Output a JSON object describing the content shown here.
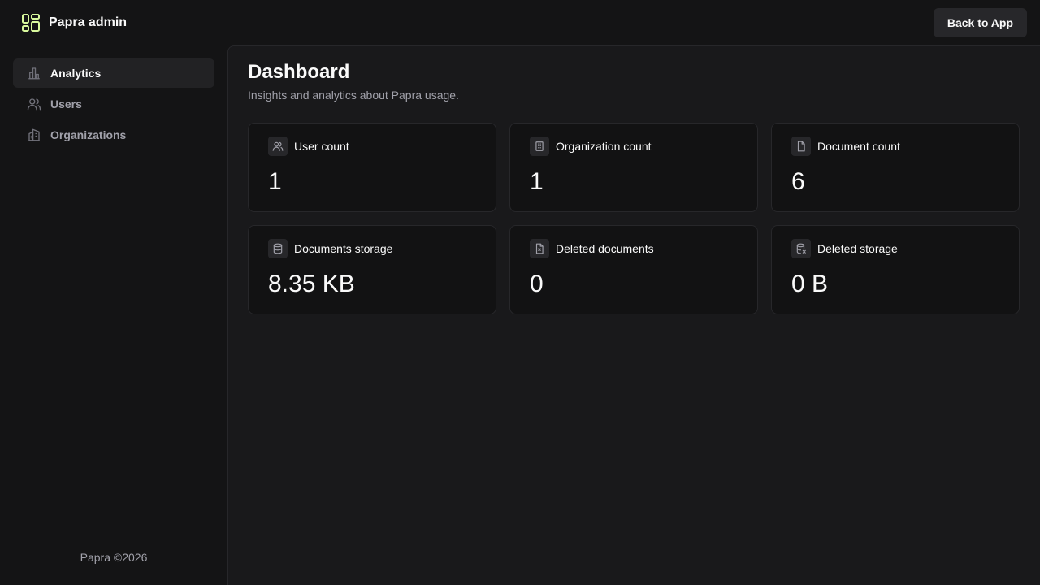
{
  "header": {
    "app_title": "Papra admin",
    "back_button_label": "Back to App"
  },
  "sidebar": {
    "items": [
      {
        "label": "Analytics",
        "icon": "bar-chart-icon",
        "active": true
      },
      {
        "label": "Users",
        "icon": "users-icon",
        "active": false
      },
      {
        "label": "Organizations",
        "icon": "buildings-icon",
        "active": false
      }
    ],
    "footer": "Papra ©2026"
  },
  "main": {
    "title": "Dashboard",
    "subtitle": "Insights and analytics about Papra usage.",
    "stats": [
      {
        "label": "User count",
        "value": "1",
        "icon": "users-icon"
      },
      {
        "label": "Organization count",
        "value": "1",
        "icon": "building-icon"
      },
      {
        "label": "Document count",
        "value": "6",
        "icon": "file-icon"
      },
      {
        "label": "Documents storage",
        "value": "8.35 KB",
        "icon": "database-icon"
      },
      {
        "label": "Deleted documents",
        "value": "0",
        "icon": "file-x-icon"
      },
      {
        "label": "Deleted storage",
        "value": "0 B",
        "icon": "database-x-icon"
      }
    ]
  },
  "colors": {
    "accent": "#d9f99d",
    "background": "#141415",
    "panel": "#19191b",
    "card": "#121213"
  }
}
